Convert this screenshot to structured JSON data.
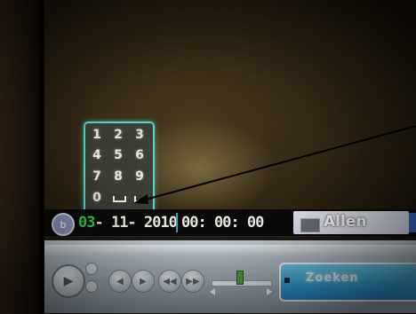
{
  "keypad": {
    "keys": [
      "1",
      "2",
      "3",
      "4",
      "5",
      "6",
      "7",
      "8",
      "9",
      "0"
    ]
  },
  "status": {
    "date_day": "03",
    "date_rest": "- 11- 2010",
    "time": "00: 00: 00",
    "camera": "Allen",
    "round_button_glyph": "b"
  },
  "controls": {
    "display_text": "Zoeken"
  },
  "colors": {
    "keypad_border": "#4fd8d0",
    "date_day": "#27d04a",
    "panel_blue": "#33a8e0",
    "slider_thumb": "#53a23a"
  }
}
